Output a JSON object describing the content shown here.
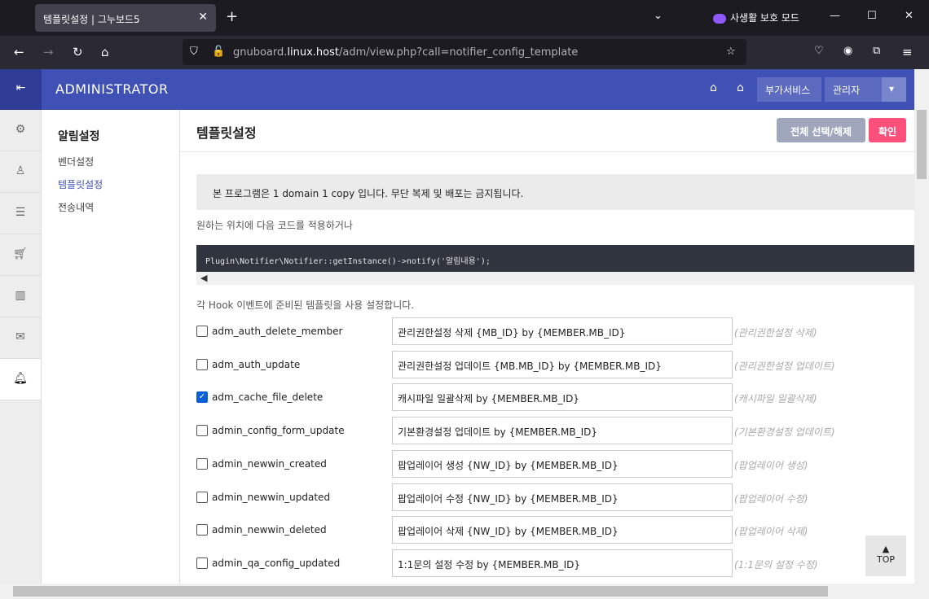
{
  "browser": {
    "tab_title": "템플릿설정 | 그누보드5",
    "private_label": "사생활 보호 모드",
    "url_prefix": "gnuboard.",
    "url_host": "linux.host",
    "url_path": "/adm/view.php?call=notifier_config_template"
  },
  "header": {
    "title": "ADMINISTRATOR",
    "addon_label": "부가서비스",
    "admin_label": "관리자"
  },
  "submenu": {
    "heading": "알림설정",
    "items": [
      "벤더설정",
      "템플릿설정",
      "전송내역"
    ]
  },
  "main": {
    "title": "템플릿설정",
    "toggle_all_label": "전체 선택/해제",
    "confirm_label": "확인",
    "notice": "본 프로그램은 1 domain 1 copy 입니다. 무단 복제 및 배포는 금지됩니다.",
    "apply_label": "원하는 위치에 다음 코드를 적용하거나",
    "code": "Plugin\\Notifier\\Notifier::getInstance()->notify('알림내용');",
    "hook_label": "각 Hook 이벤트에 준비된 템플릿을 사용 설정합니다.",
    "rows": [
      {
        "hook": "adm_auth_delete_member",
        "value": "관리권한설정 삭제 {MB_ID} by {MEMBER.MB_ID}",
        "placeholder": "(관리권한설정 삭제)",
        "checked": false
      },
      {
        "hook": "adm_auth_update",
        "value": "관리권한설정 업데이트 {MB.MB_ID} by {MEMBER.MB_ID}",
        "placeholder": "(관리권한설정 업데이트)",
        "checked": false
      },
      {
        "hook": "adm_cache_file_delete",
        "value": "캐시파일 일괄삭제 by {MEMBER.MB_ID}",
        "placeholder": "(캐시파일 일괄삭제)",
        "checked": true
      },
      {
        "hook": "admin_config_form_update",
        "value": "기본환경설정 업데이트 by {MEMBER.MB_ID}",
        "placeholder": "(기본환경설정 업데이트)",
        "checked": false
      },
      {
        "hook": "admin_newwin_created",
        "value": "팝업레이어 생성 {NW_ID} by {MEMBER.MB_ID}",
        "placeholder": "(팝업레이어 생성)",
        "checked": false
      },
      {
        "hook": "admin_newwin_updated",
        "value": "팝업레이어 수정 {NW_ID} by {MEMBER.MB_ID}",
        "placeholder": "(팝업레이어 수정)",
        "checked": false
      },
      {
        "hook": "admin_newwin_deleted",
        "value": "팝업레이어 삭제 {NW_ID} by {MEMBER.MB_ID}",
        "placeholder": "(팝업레이어 삭제)",
        "checked": false
      },
      {
        "hook": "admin_qa_config_updated",
        "value": "1:1문의 설정 수정 by {MEMBER.MB_ID}",
        "placeholder": "(1:1문의 설정 수정)",
        "checked": false
      }
    ]
  },
  "top_button": {
    "label": "TOP"
  }
}
